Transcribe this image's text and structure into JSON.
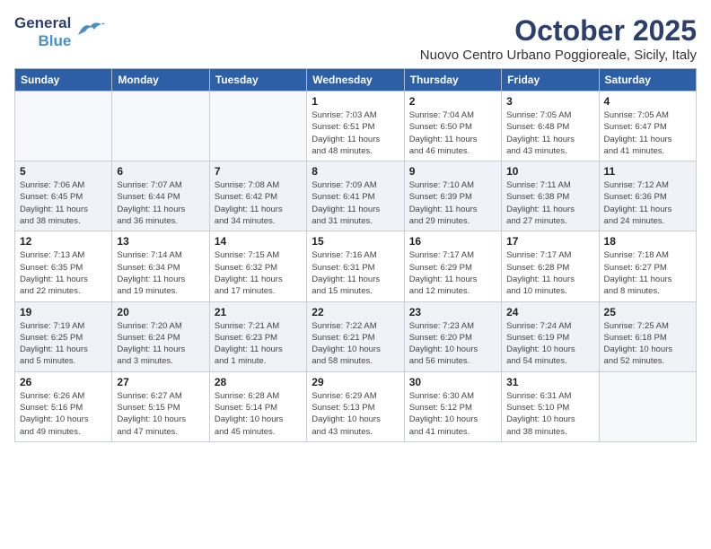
{
  "header": {
    "logo_general": "General",
    "logo_blue": "Blue",
    "month_year": "October 2025",
    "location": "Nuovo Centro Urbano Poggioreale, Sicily, Italy"
  },
  "weekdays": [
    "Sunday",
    "Monday",
    "Tuesday",
    "Wednesday",
    "Thursday",
    "Friday",
    "Saturday"
  ],
  "weeks": [
    [
      {
        "day": "",
        "info": ""
      },
      {
        "day": "",
        "info": ""
      },
      {
        "day": "",
        "info": ""
      },
      {
        "day": "1",
        "info": "Sunrise: 7:03 AM\nSunset: 6:51 PM\nDaylight: 11 hours\nand 48 minutes."
      },
      {
        "day": "2",
        "info": "Sunrise: 7:04 AM\nSunset: 6:50 PM\nDaylight: 11 hours\nand 46 minutes."
      },
      {
        "day": "3",
        "info": "Sunrise: 7:05 AM\nSunset: 6:48 PM\nDaylight: 11 hours\nand 43 minutes."
      },
      {
        "day": "4",
        "info": "Sunrise: 7:05 AM\nSunset: 6:47 PM\nDaylight: 11 hours\nand 41 minutes."
      }
    ],
    [
      {
        "day": "5",
        "info": "Sunrise: 7:06 AM\nSunset: 6:45 PM\nDaylight: 11 hours\nand 38 minutes."
      },
      {
        "day": "6",
        "info": "Sunrise: 7:07 AM\nSunset: 6:44 PM\nDaylight: 11 hours\nand 36 minutes."
      },
      {
        "day": "7",
        "info": "Sunrise: 7:08 AM\nSunset: 6:42 PM\nDaylight: 11 hours\nand 34 minutes."
      },
      {
        "day": "8",
        "info": "Sunrise: 7:09 AM\nSunset: 6:41 PM\nDaylight: 11 hours\nand 31 minutes."
      },
      {
        "day": "9",
        "info": "Sunrise: 7:10 AM\nSunset: 6:39 PM\nDaylight: 11 hours\nand 29 minutes."
      },
      {
        "day": "10",
        "info": "Sunrise: 7:11 AM\nSunset: 6:38 PM\nDaylight: 11 hours\nand 27 minutes."
      },
      {
        "day": "11",
        "info": "Sunrise: 7:12 AM\nSunset: 6:36 PM\nDaylight: 11 hours\nand 24 minutes."
      }
    ],
    [
      {
        "day": "12",
        "info": "Sunrise: 7:13 AM\nSunset: 6:35 PM\nDaylight: 11 hours\nand 22 minutes."
      },
      {
        "day": "13",
        "info": "Sunrise: 7:14 AM\nSunset: 6:34 PM\nDaylight: 11 hours\nand 19 minutes."
      },
      {
        "day": "14",
        "info": "Sunrise: 7:15 AM\nSunset: 6:32 PM\nDaylight: 11 hours\nand 17 minutes."
      },
      {
        "day": "15",
        "info": "Sunrise: 7:16 AM\nSunset: 6:31 PM\nDaylight: 11 hours\nand 15 minutes."
      },
      {
        "day": "16",
        "info": "Sunrise: 7:17 AM\nSunset: 6:29 PM\nDaylight: 11 hours\nand 12 minutes."
      },
      {
        "day": "17",
        "info": "Sunrise: 7:17 AM\nSunset: 6:28 PM\nDaylight: 11 hours\nand 10 minutes."
      },
      {
        "day": "18",
        "info": "Sunrise: 7:18 AM\nSunset: 6:27 PM\nDaylight: 11 hours\nand 8 minutes."
      }
    ],
    [
      {
        "day": "19",
        "info": "Sunrise: 7:19 AM\nSunset: 6:25 PM\nDaylight: 11 hours\nand 5 minutes."
      },
      {
        "day": "20",
        "info": "Sunrise: 7:20 AM\nSunset: 6:24 PM\nDaylight: 11 hours\nand 3 minutes."
      },
      {
        "day": "21",
        "info": "Sunrise: 7:21 AM\nSunset: 6:23 PM\nDaylight: 11 hours\nand 1 minute."
      },
      {
        "day": "22",
        "info": "Sunrise: 7:22 AM\nSunset: 6:21 PM\nDaylight: 10 hours\nand 58 minutes."
      },
      {
        "day": "23",
        "info": "Sunrise: 7:23 AM\nSunset: 6:20 PM\nDaylight: 10 hours\nand 56 minutes."
      },
      {
        "day": "24",
        "info": "Sunrise: 7:24 AM\nSunset: 6:19 PM\nDaylight: 10 hours\nand 54 minutes."
      },
      {
        "day": "25",
        "info": "Sunrise: 7:25 AM\nSunset: 6:18 PM\nDaylight: 10 hours\nand 52 minutes."
      }
    ],
    [
      {
        "day": "26",
        "info": "Sunrise: 6:26 AM\nSunset: 5:16 PM\nDaylight: 10 hours\nand 49 minutes."
      },
      {
        "day": "27",
        "info": "Sunrise: 6:27 AM\nSunset: 5:15 PM\nDaylight: 10 hours\nand 47 minutes."
      },
      {
        "day": "28",
        "info": "Sunrise: 6:28 AM\nSunset: 5:14 PM\nDaylight: 10 hours\nand 45 minutes."
      },
      {
        "day": "29",
        "info": "Sunrise: 6:29 AM\nSunset: 5:13 PM\nDaylight: 10 hours\nand 43 minutes."
      },
      {
        "day": "30",
        "info": "Sunrise: 6:30 AM\nSunset: 5:12 PM\nDaylight: 10 hours\nand 41 minutes."
      },
      {
        "day": "31",
        "info": "Sunrise: 6:31 AM\nSunset: 5:10 PM\nDaylight: 10 hours\nand 38 minutes."
      },
      {
        "day": "",
        "info": ""
      }
    ]
  ]
}
